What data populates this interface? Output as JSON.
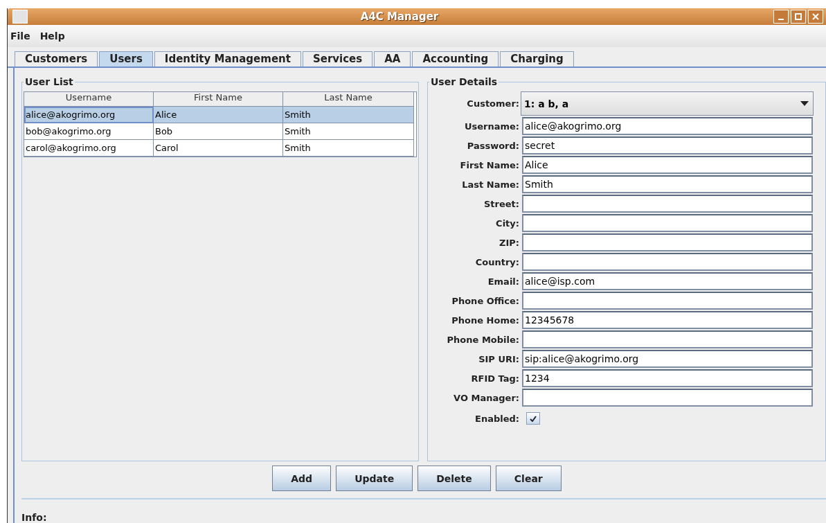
{
  "window": {
    "title": "A4C Manager"
  },
  "menu": [
    "File",
    "Help"
  ],
  "tabs": [
    {
      "label": "Customers",
      "selected": false
    },
    {
      "label": "Users",
      "selected": true
    },
    {
      "label": "Identity Management",
      "selected": false
    },
    {
      "label": "Services",
      "selected": false
    },
    {
      "label": "AA",
      "selected": false
    },
    {
      "label": "Accounting",
      "selected": false
    },
    {
      "label": "Charging",
      "selected": false
    }
  ],
  "user_list": {
    "title": "User List",
    "columns": [
      "Username",
      "First Name",
      "Last Name"
    ],
    "rows": [
      {
        "cells": [
          "alice@akogrimo.org",
          "Alice",
          "Smith"
        ],
        "selected": true
      },
      {
        "cells": [
          "bob@akogrimo.org",
          "Bob",
          "Smith"
        ],
        "selected": false
      },
      {
        "cells": [
          "carol@akogrimo.org",
          "Carol",
          "Smith"
        ],
        "selected": false
      }
    ]
  },
  "user_details": {
    "title": "User Details",
    "fields": [
      {
        "kind": "combo",
        "label": "Customer:",
        "value": "1: a b, a"
      },
      {
        "kind": "text",
        "label": "Username:",
        "value": "alice@akogrimo.org"
      },
      {
        "kind": "text",
        "label": "Password:",
        "value": "secret"
      },
      {
        "kind": "text",
        "label": "First Name:",
        "value": "Alice"
      },
      {
        "kind": "text",
        "label": "Last Name:",
        "value": "Smith"
      },
      {
        "kind": "text",
        "label": "Street:"
      },
      {
        "kind": "text",
        "label": "City:"
      },
      {
        "kind": "text",
        "label": "ZIP:"
      },
      {
        "kind": "text",
        "label": "Country:"
      },
      {
        "kind": "text",
        "label": "Email:",
        "value": "alice@isp.com"
      },
      {
        "kind": "text",
        "label": "Phone Office:"
      },
      {
        "kind": "text",
        "label": "Phone Home:",
        "value": "12345678"
      },
      {
        "kind": "text",
        "label": "Phone Mobile:"
      },
      {
        "kind": "text",
        "label": "SIP URI:",
        "value": "sip:alice@akogrimo.org"
      },
      {
        "kind": "text",
        "label": "RFID Tag:",
        "value": "1234"
      },
      {
        "kind": "text",
        "label": "VO Manager:"
      },
      {
        "kind": "checkbox",
        "label": "Enabled:",
        "checked": true
      }
    ]
  },
  "buttons": [
    "Add",
    "Update",
    "Delete",
    "Clear"
  ],
  "status_bar": {
    "label": "Info:"
  }
}
